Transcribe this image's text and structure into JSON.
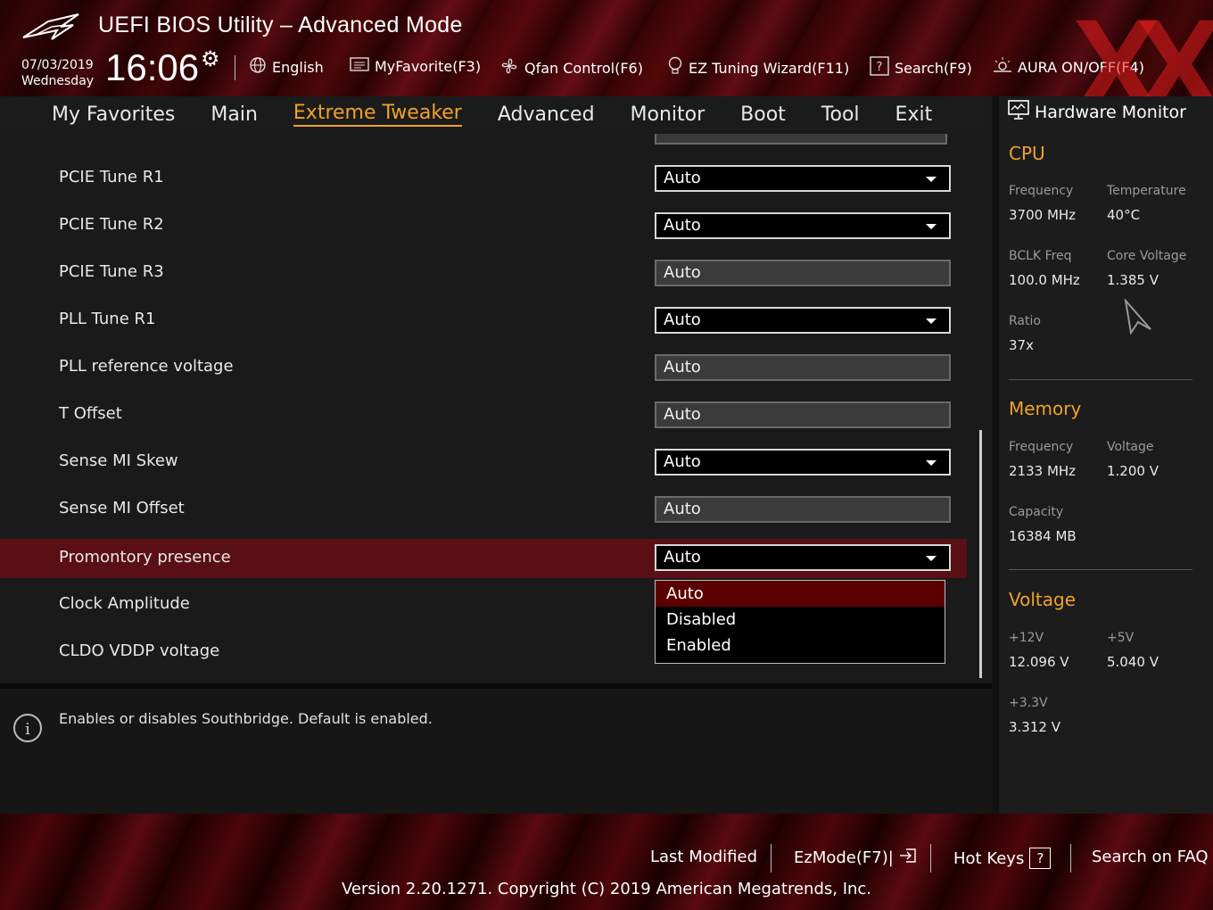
{
  "header": {
    "title": "UEFI BIOS Utility – Advanced Mode",
    "date": "07/03/2019",
    "weekday": "Wednesday",
    "time": "16:06",
    "tools": [
      {
        "label": "English",
        "icon": "globe-icon"
      },
      {
        "label": "MyFavorite(F3)",
        "icon": "favorite-list-icon"
      },
      {
        "label": "Qfan Control(F6)",
        "icon": "fan-icon"
      },
      {
        "label": "EZ Tuning Wizard(F11)",
        "icon": "lightbulb-icon"
      },
      {
        "label": "Search(F9)",
        "icon": "help-box-icon"
      },
      {
        "label": "AURA ON/OFF(F4)",
        "icon": "aura-light-icon"
      }
    ],
    "watermark": "XX"
  },
  "nav": {
    "tabs": [
      "My Favorites",
      "Main",
      "Extreme Tweaker",
      "Advanced",
      "Monitor",
      "Boot",
      "Tool",
      "Exit"
    ],
    "active": "Extreme Tweaker"
  },
  "settings": [
    {
      "label": "PCIE Tune R1",
      "value": "Auto",
      "editable": true
    },
    {
      "label": "PCIE Tune R2",
      "value": "Auto",
      "editable": true
    },
    {
      "label": "PCIE Tune R3",
      "value": "Auto",
      "editable": false
    },
    {
      "label": "PLL Tune R1",
      "value": "Auto",
      "editable": true
    },
    {
      "label": "PLL reference voltage",
      "value": "Auto",
      "editable": false
    },
    {
      "label": "T Offset",
      "value": "Auto",
      "editable": false
    },
    {
      "label": "Sense MI Skew",
      "value": "Auto",
      "editable": true
    },
    {
      "label": "Sense MI Offset",
      "value": "Auto",
      "editable": false
    },
    {
      "label": "Promontory presence",
      "value": "Auto",
      "editable": true,
      "selected": true
    },
    {
      "label": "Clock Amplitude",
      "value": "",
      "editable": true
    },
    {
      "label": "CLDO VDDP voltage",
      "value": "",
      "editable": true
    }
  ],
  "dropdown_options": [
    "Auto",
    "Disabled",
    "Enabled"
  ],
  "dropdown_highlight": "Auto",
  "info": {
    "text": "Enables or disables Southbridge. Default is enabled."
  },
  "hardware_monitor": {
    "title": "Hardware Monitor",
    "cpu": {
      "heading": "CPU",
      "frequency_label": "Frequency",
      "frequency": "3700 MHz",
      "temperature_label": "Temperature",
      "temperature": "40°C",
      "bclk_label": "BCLK Freq",
      "bclk": "100.0 MHz",
      "core_voltage_label": "Core Voltage",
      "core_voltage": "1.385 V",
      "ratio_label": "Ratio",
      "ratio": "37x"
    },
    "memory": {
      "heading": "Memory",
      "frequency_label": "Frequency",
      "frequency": "2133 MHz",
      "voltage_label": "Voltage",
      "voltage": "1.200 V",
      "capacity_label": "Capacity",
      "capacity": "16384 MB"
    },
    "voltage": {
      "heading": "Voltage",
      "v12_label": "+12V",
      "v12": "12.096 V",
      "v5_label": "+5V",
      "v5": "5.040 V",
      "v33_label": "+3.3V",
      "v33": "3.312 V"
    }
  },
  "footer": {
    "last_modified": "Last Modified",
    "ezmode": "EzMode(F7)|",
    "hotkeys": "Hot Keys",
    "hotkeys_key": "?",
    "faq": "Search on FAQ",
    "version": "Version 2.20.1271. Copyright (C) 2019 American Megatrends, Inc."
  },
  "colors": {
    "accent": "#f0a22a",
    "selected_row": "#5a0f14",
    "brand_red": "#b01018"
  }
}
